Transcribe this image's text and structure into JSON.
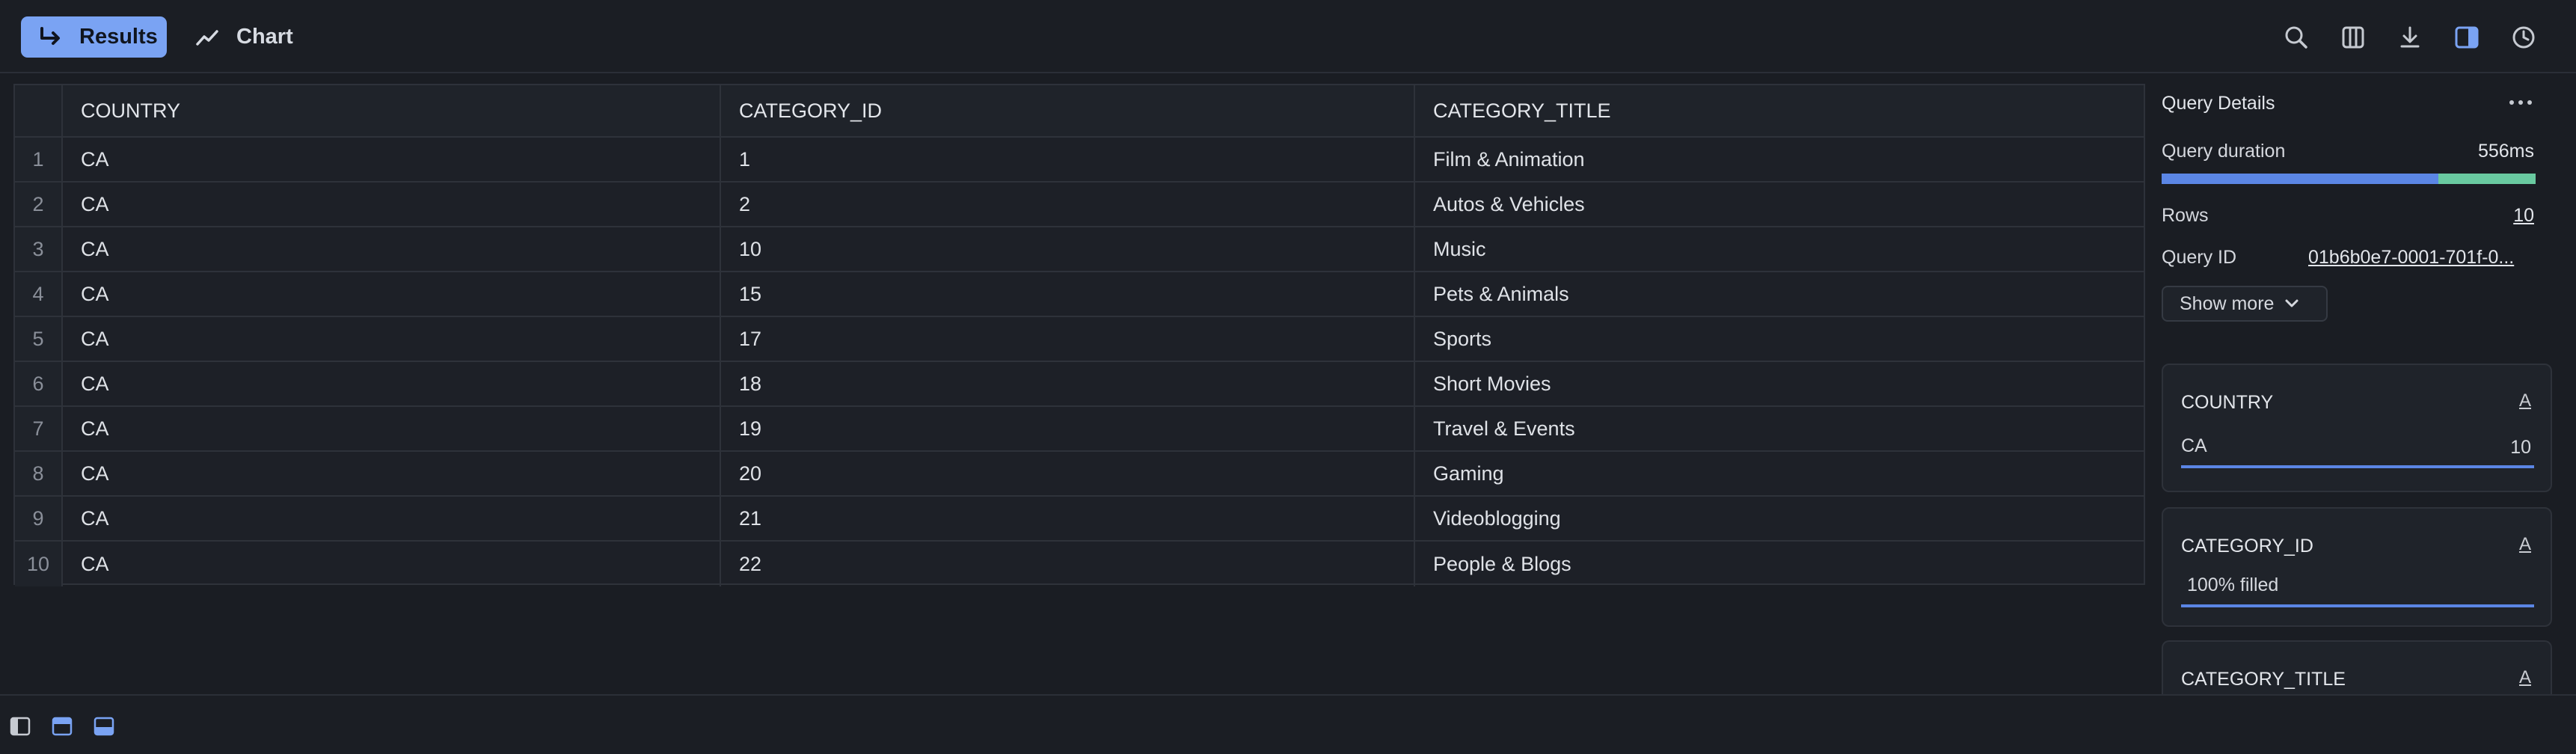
{
  "toolbar": {
    "results_label": "Results",
    "chart_label": "Chart",
    "icons": [
      "search-icon",
      "columns-icon",
      "download-icon",
      "side-panel-icon",
      "history-icon"
    ]
  },
  "table": {
    "headers": [
      "COUNTRY",
      "CATEGORY_ID",
      "CATEGORY_TITLE"
    ],
    "rows": [
      {
        "idx": "1",
        "country": "CA",
        "category_id": "1",
        "category_title": "Film & Animation"
      },
      {
        "idx": "2",
        "country": "CA",
        "category_id": "2",
        "category_title": "Autos & Vehicles"
      },
      {
        "idx": "3",
        "country": "CA",
        "category_id": "10",
        "category_title": "Music"
      },
      {
        "idx": "4",
        "country": "CA",
        "category_id": "15",
        "category_title": "Pets & Animals"
      },
      {
        "idx": "5",
        "country": "CA",
        "category_id": "17",
        "category_title": "Sports"
      },
      {
        "idx": "6",
        "country": "CA",
        "category_id": "18",
        "category_title": "Short Movies"
      },
      {
        "idx": "7",
        "country": "CA",
        "category_id": "19",
        "category_title": "Travel & Events"
      },
      {
        "idx": "8",
        "country": "CA",
        "category_id": "20",
        "category_title": "Gaming"
      },
      {
        "idx": "9",
        "country": "CA",
        "category_id": "21",
        "category_title": "Videoblogging"
      },
      {
        "idx": "10",
        "country": "CA",
        "category_id": "22",
        "category_title": "People & Blogs"
      }
    ]
  },
  "details": {
    "title": "Query Details",
    "duration_label": "Query duration",
    "duration_value": "556ms",
    "duration_bar_fraction": 0.74,
    "rows_label": "Rows",
    "rows_value": "10",
    "query_id_label": "Query ID",
    "query_id_value": "01b6b0e7-0001-701f-0...",
    "show_more_label": "Show more"
  },
  "columns": [
    {
      "name": "COUNTRY",
      "type": "A",
      "value": "CA",
      "count": "10"
    },
    {
      "name": "CATEGORY_ID",
      "type": "A",
      "value": "100% filled"
    },
    {
      "name": "CATEGORY_TITLE",
      "type": "A"
    }
  ],
  "colors": {
    "accent": "#7aa3f3",
    "bar_primary": "#5b86e5",
    "bar_secondary": "#69c9a0",
    "background": "#1a1d23"
  }
}
